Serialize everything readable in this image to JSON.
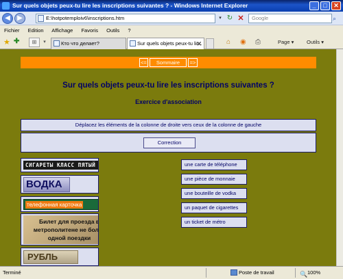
{
  "window": {
    "title": "Sur quels objets peux-tu lire les inscriptions suivantes ? - Windows Internet Explorer",
    "minimize": "_",
    "maximize": "□",
    "close": "✕"
  },
  "address": {
    "back": "◀",
    "forward": "▶",
    "url": "E:\\hotpotemploiv6\\inscriptions.htm",
    "dropdown": "▾",
    "refresh": "↻",
    "stop": "✕",
    "search_placeholder": "Google",
    "search_go": "⌕"
  },
  "menu": [
    "Fichier",
    "Edition",
    "Affichage",
    "Favoris",
    "Outils",
    "?"
  ],
  "tabs": {
    "tab1": "Кто что делает?",
    "tab2": "Sur quels objets peux-tu lir...",
    "close": "✕",
    "favorites": "★",
    "add_favorite": "✚",
    "tab_list": "⊞",
    "tab_list_dropdown": "▾"
  },
  "commands": {
    "home": "⌂",
    "feeds": "◉",
    "print": "⎙",
    "page": "Page ▾",
    "tools": "Outils ▾"
  },
  "page": {
    "nav_prev": "<=",
    "nav_home": "Sommaire",
    "nav_next": "=>",
    "title": "Sur quels objets peux-tu lire les inscriptions suivantes ?",
    "subtitle": "Exercice d'association",
    "instructions": "Déplacez les éléments de la colonne de droite vers ceux de la colonne de gauche",
    "correction": "Correction",
    "pictures": [
      "СИГАРЕТЫ КЛАСС ПЯТЫЙ",
      "ВОДКА",
      "телефонная карточка",
      "Билет для проезда в метрополитене не более одной поездки",
      "РУБЛЬ"
    ],
    "ticket_lines": [
      "Билет для проезда в",
      "метрополитене не более",
      "одной поездки"
    ],
    "answers": [
      "une carte de téléphone",
      "une pièce de monnaie",
      "une bouteille de vodka",
      "un paquet de cigarettes",
      "un ticket de métro"
    ]
  },
  "status": {
    "text": "Terminé",
    "zone": "Poste de travail",
    "zoom": "100%",
    "zoom_icon": "🔍"
  },
  "colors": {
    "page_background": "#7b7b0d",
    "nav_bar": "#ff8c00",
    "title_text": "#000066",
    "cell_background": "#dcdff0"
  }
}
